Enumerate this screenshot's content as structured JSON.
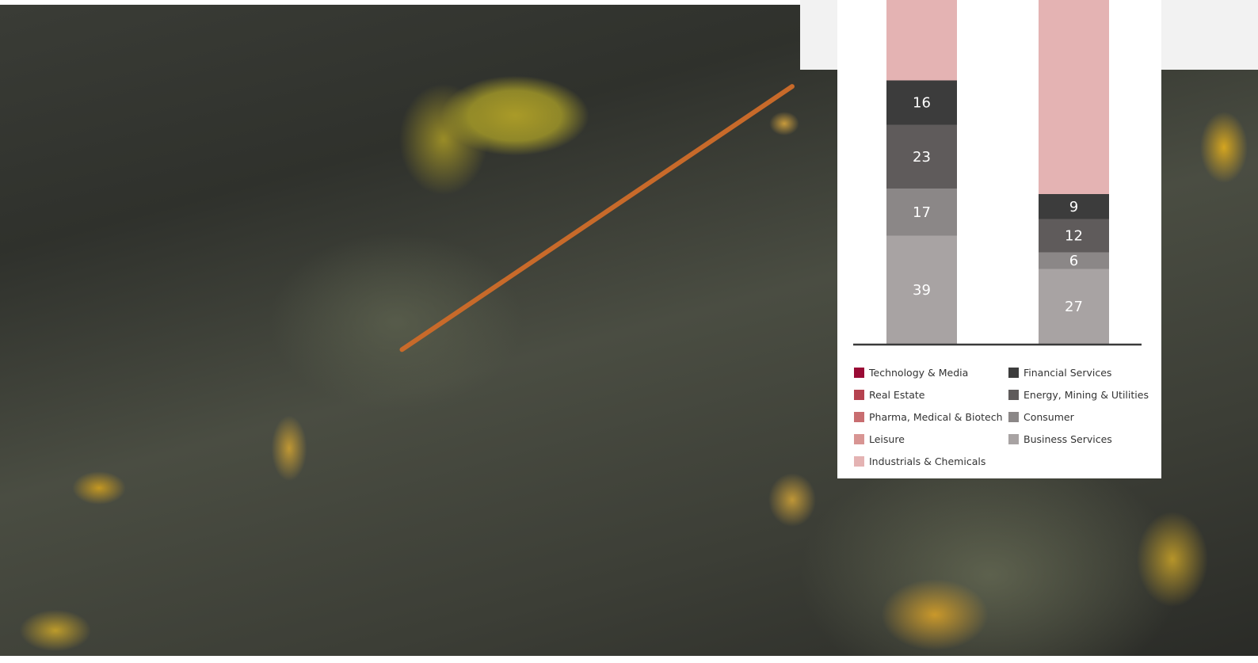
{
  "chart_data": {
    "type": "bar",
    "stacked": true,
    "categories": [
      "",
      ""
    ],
    "series": [
      {
        "name": "Business Services",
        "color": "#a8a3a3",
        "values": [
          39,
          27
        ]
      },
      {
        "name": "Consumer",
        "color": "#8b8787",
        "values": [
          17,
          6
        ]
      },
      {
        "name": "Energy, Mining & Utilities",
        "color": "#5f5b5b",
        "values": [
          23,
          12
        ]
      },
      {
        "name": "Financial Services",
        "color": "#3c3c3c",
        "values": [
          16,
          9
        ]
      },
      {
        "name": "Industrials & Chemicals",
        "color": "#e4b3b3",
        "values": [
          null,
          null
        ]
      }
    ],
    "legend": [
      {
        "name": "Technology & Media",
        "color": "#9a0b35"
      },
      {
        "name": "Real Estate",
        "color": "#b5424f"
      },
      {
        "name": "Pharma, Medical & Biotech",
        "color": "#c86d70"
      },
      {
        "name": "Leisure",
        "color": "#d89593"
      },
      {
        "name": "Industrials & Chemicals",
        "color": "#e4b3b3"
      },
      {
        "name": "Financial Services",
        "color": "#3c3c3c"
      },
      {
        "name": "Energy, Mining & Utilities",
        "color": "#5f5b5b"
      },
      {
        "name": "Consumer",
        "color": "#8b8787"
      },
      {
        "name": "Business Services",
        "color": "#a8a3a3"
      }
    ],
    "legend_placement": "bottom",
    "grid": false,
    "value_labels": true
  }
}
